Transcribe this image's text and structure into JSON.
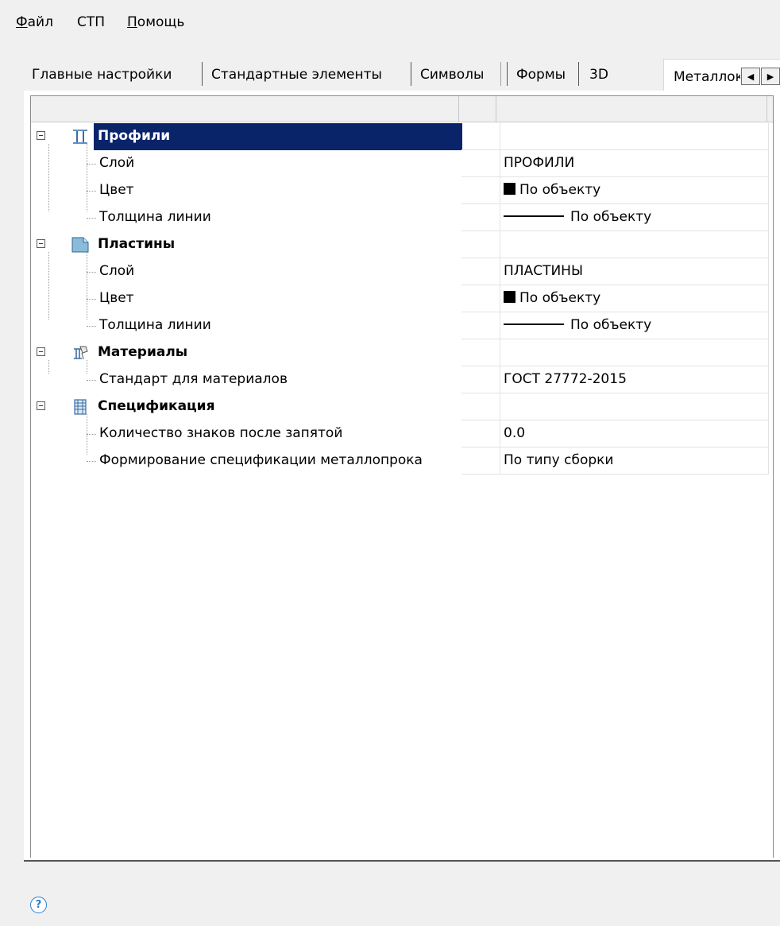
{
  "menu": [
    {
      "accel": "Ф",
      "rest": "айл"
    },
    {
      "accel": "",
      "rest": "СТП"
    },
    {
      "accel": "П",
      "rest": "омощь"
    }
  ],
  "tabs": [
    "Главные настройки",
    "Стандартные элементы",
    "Символы",
    "Формы",
    "3D"
  ],
  "active_tab": "Металлоконструкции",
  "tab_scroll": {
    "left": "◀",
    "right": "▶"
  },
  "groups": {
    "profiles": {
      "title": "Профили",
      "icon": "i-beam-profile-icon",
      "props": [
        {
          "name": "Слой",
          "value": "ПРОФИЛИ"
        },
        {
          "name": "Цвет",
          "value": "По объекту"
        },
        {
          "name": "Толщина линии",
          "value": "По объекту"
        }
      ]
    },
    "plates": {
      "title": "Пластины",
      "icon": "plate-icon",
      "props": [
        {
          "name": "Слой",
          "value": "ПЛАСТИНЫ"
        },
        {
          "name": "Цвет",
          "value": "По объекту"
        },
        {
          "name": "Толщина линии",
          "value": "По объекту"
        }
      ]
    },
    "materials": {
      "title": "Материалы",
      "icon": "materials-icon",
      "props": [
        {
          "name": "Стандарт для материалов",
          "value": "ГОСТ 27772-2015"
        }
      ]
    },
    "spec": {
      "title": "Спецификация",
      "icon": "specification-icon",
      "props": [
        {
          "name": "Количество знаков после запятой",
          "value": "0.0"
        },
        {
          "name": "Формирование спецификации металлопрока",
          "value": "По типу сборки"
        }
      ]
    }
  },
  "colors": {
    "selection": "#0a246a",
    "help": "#2a7fd1",
    "background": "#f0f0f0"
  },
  "help_icon": "?"
}
